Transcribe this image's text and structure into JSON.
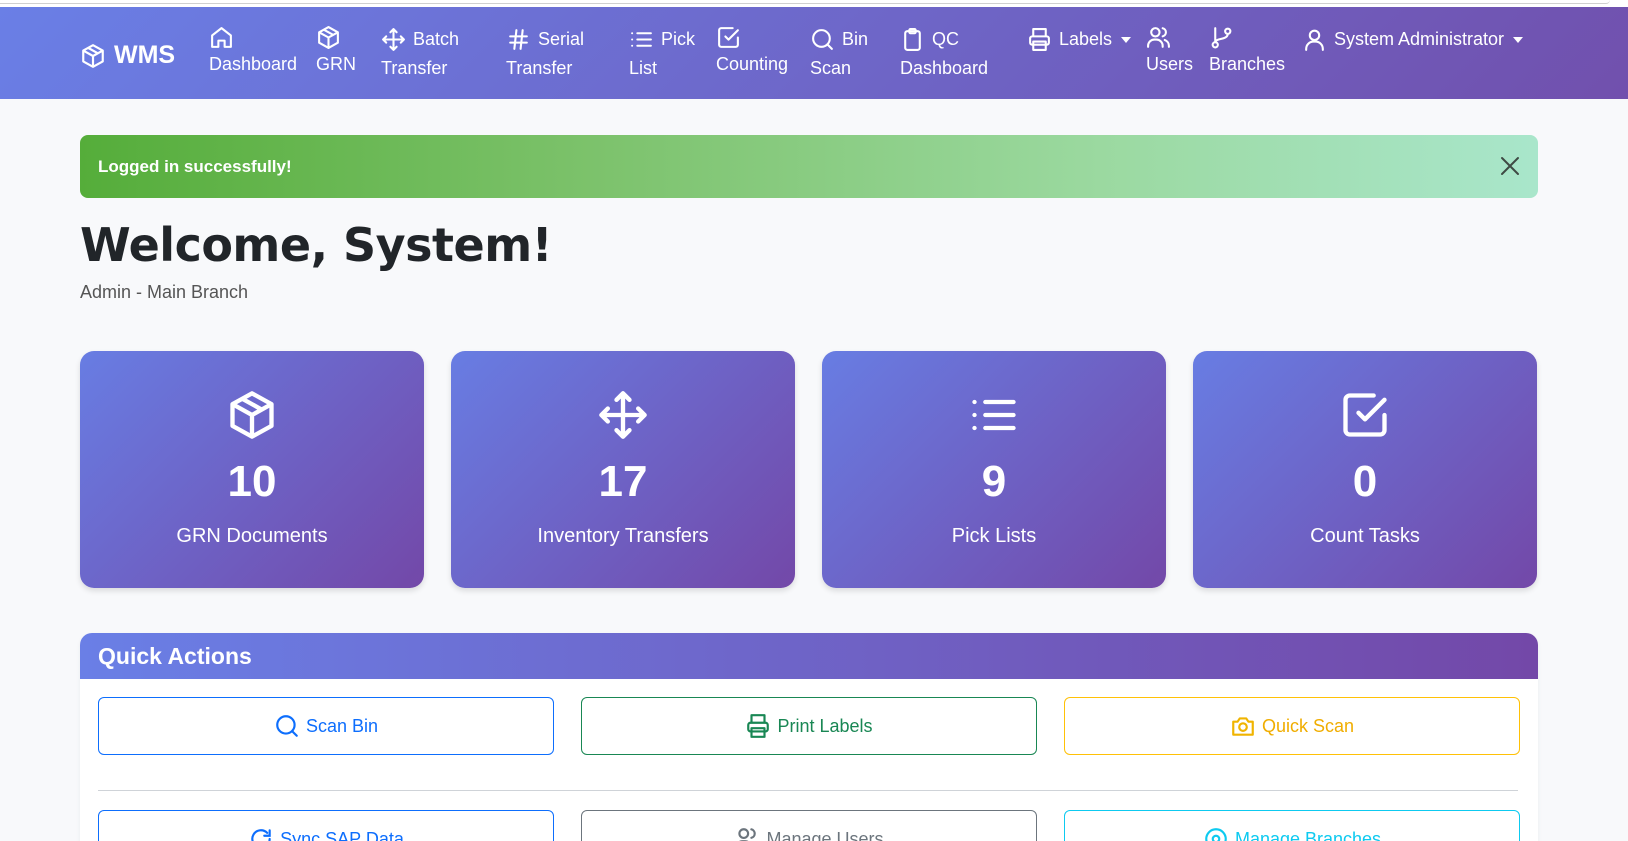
{
  "app": {
    "brand": "WMS"
  },
  "nav": {
    "items": [
      {
        "label1": "",
        "label2": "Dashboard",
        "icon": "home-icon"
      },
      {
        "label1": "",
        "label2": "GRN",
        "icon": "box-icon"
      },
      {
        "label1": "Batch",
        "label2": "Transfer",
        "icon": "move-icon"
      },
      {
        "label1": "Serial",
        "label2": "Transfer",
        "icon": "hash-icon"
      },
      {
        "label1": "Pick",
        "label2": "List",
        "icon": "list-icon"
      },
      {
        "label1": "",
        "label2": "Counting",
        "icon": "check-square-icon"
      },
      {
        "label1": "Bin",
        "label2": "Scan",
        "icon": "search-icon"
      },
      {
        "label1": "QC",
        "label2": "Dashboard",
        "icon": "clipboard-icon"
      },
      {
        "label1": "Labels",
        "label2": "",
        "icon": "printer-icon"
      },
      {
        "label1": "",
        "label2": "Users",
        "icon": "users-icon"
      },
      {
        "label1": "",
        "label2": "Branches",
        "icon": "git-branch-icon"
      }
    ],
    "user": "System Administrator"
  },
  "alert": {
    "message": "Logged in successfully!"
  },
  "welcome": {
    "title": "Welcome, System!",
    "subtitle": "Admin - Main Branch"
  },
  "cards": [
    {
      "value": "10",
      "label": "GRN Documents",
      "icon": "box-icon"
    },
    {
      "value": "17",
      "label": "Inventory Transfers",
      "icon": "move-icon"
    },
    {
      "value": "9",
      "label": "Pick Lists",
      "icon": "list-icon"
    },
    {
      "value": "0",
      "label": "Count Tasks",
      "icon": "check-square-icon"
    }
  ],
  "quick_actions": {
    "title": "Quick Actions",
    "buttons": [
      {
        "label": "Scan Bin",
        "color": "#0d6efd",
        "icon": "search-icon"
      },
      {
        "label": "Print Labels",
        "color": "#198754",
        "icon": "printer-icon"
      },
      {
        "label": "Quick Scan",
        "color": "#ffc107",
        "icon": "camera-icon"
      },
      {
        "label": "Sync SAP Data",
        "color": "#0d6efd",
        "icon": "refresh-icon"
      },
      {
        "label": "Manage Users",
        "color": "#6c757d",
        "icon": "users-icon"
      },
      {
        "label": "Manage Branches",
        "color": "#0dcaf0",
        "icon": "map-pin-icon"
      }
    ]
  }
}
